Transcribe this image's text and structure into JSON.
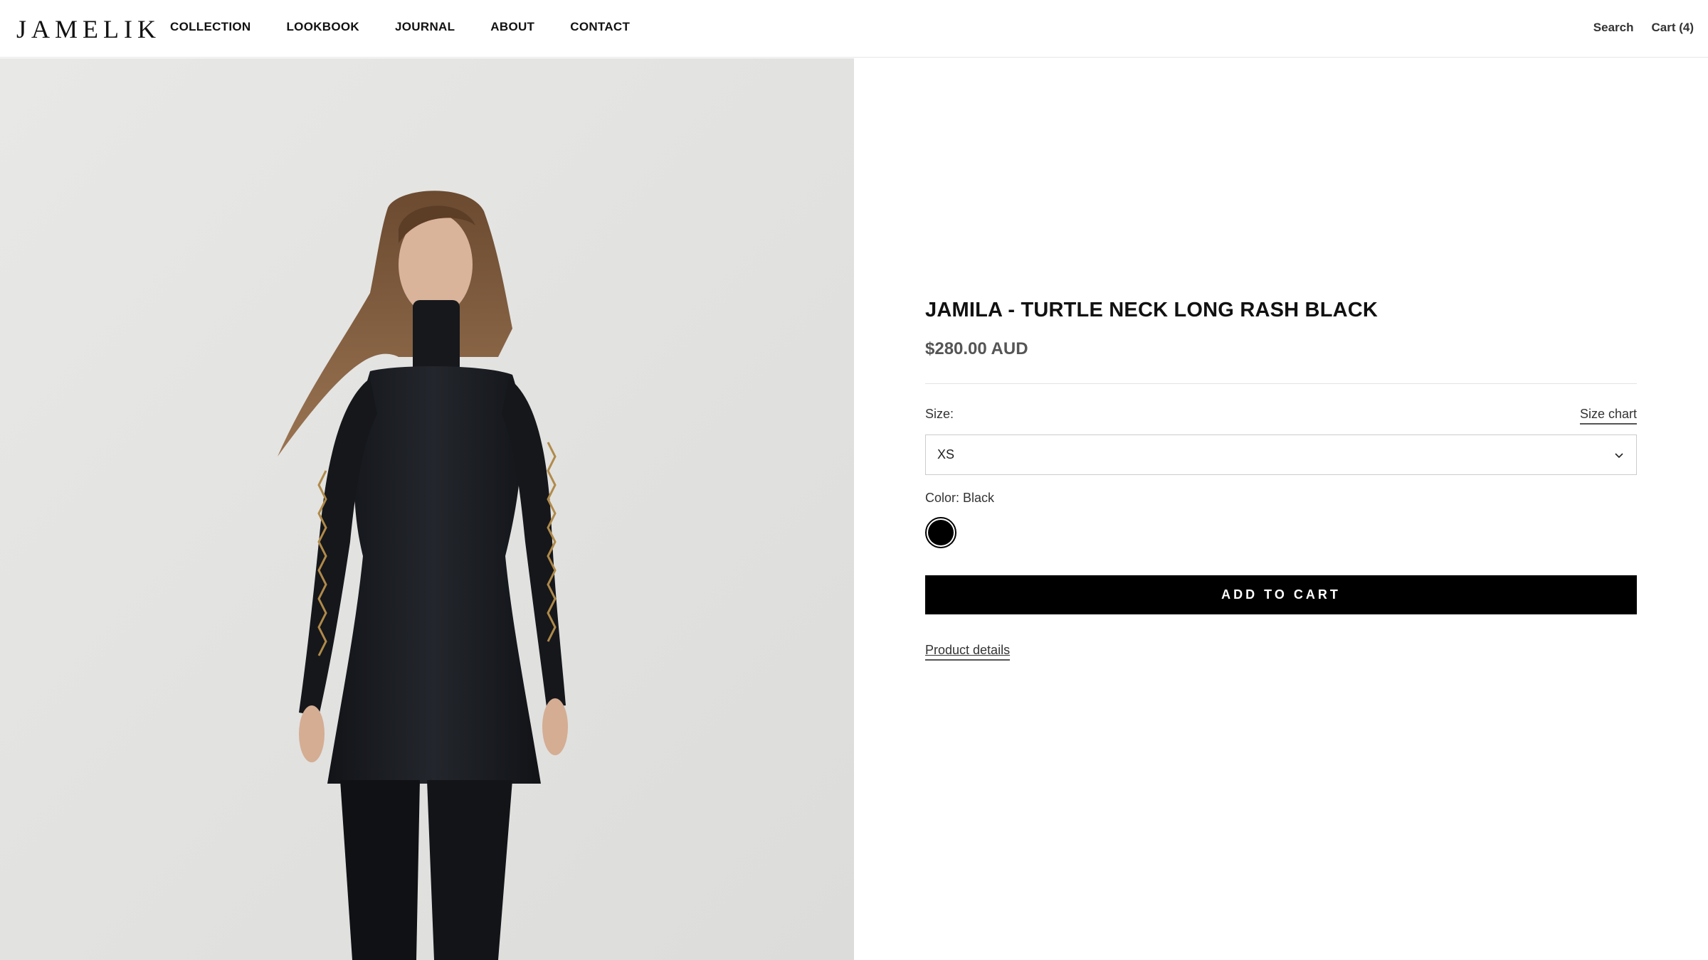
{
  "header": {
    "logo": "JAMELIK",
    "nav": [
      "COLLECTION",
      "LOOKBOOK",
      "JOURNAL",
      "ABOUT",
      "CONTACT"
    ],
    "search_label": "Search",
    "cart_label": "Cart (4)"
  },
  "product": {
    "title": "JAMILA - TURTLE NECK LONG RASH BLACK",
    "price": "$280.00 AUD",
    "size_label": "Size:",
    "size_chart_label": "Size chart",
    "size_selected": "XS",
    "color_label": "Color: Black",
    "color_swatch": "#000000",
    "add_to_cart_label": "ADD TO CART",
    "details_label": "Product details"
  },
  "icons": {
    "select_chevron": "chevron-down-icon"
  }
}
